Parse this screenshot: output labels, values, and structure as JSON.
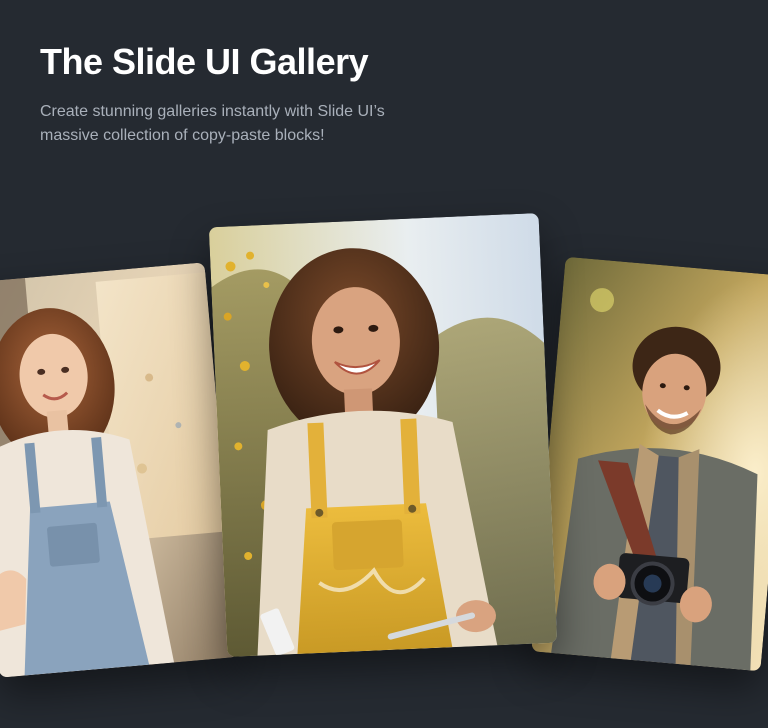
{
  "hero": {
    "title": "The Slide UI Gallery",
    "subtitle": "Create stunning galleries instantly with Slide UI’s massive collection of copy-paste blocks!"
  },
  "gallery": {
    "cards": [
      {
        "position": "left",
        "subject": "painter-woman-photo"
      },
      {
        "position": "center",
        "subject": "yellow-overalls-woman-photo"
      },
      {
        "position": "right",
        "subject": "photographer-man-photo"
      }
    ]
  },
  "colors": {
    "background": "#252a31",
    "title": "#ffffff",
    "subtitle": "#a9b0ba",
    "overalls_yellow": "#e2b035",
    "overalls_blue": "#8aa3bd"
  }
}
